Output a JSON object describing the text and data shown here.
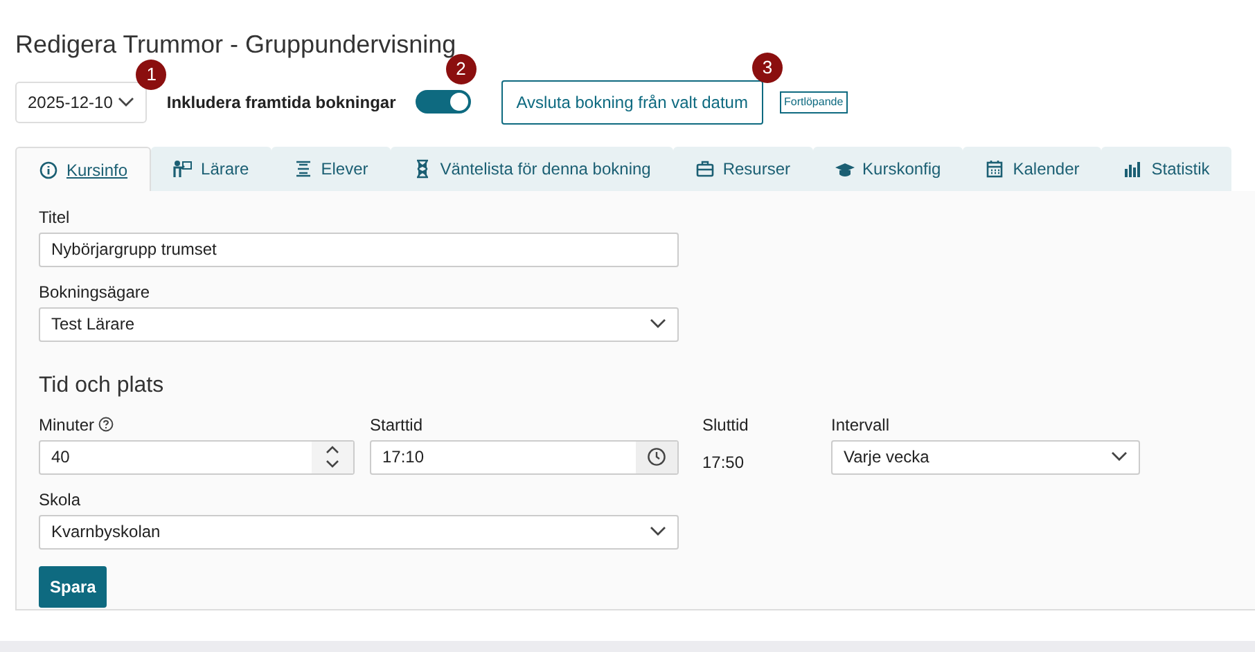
{
  "title": "Redigera Trummor - Gruppundervisning",
  "toolbar": {
    "date": "2025-12-10",
    "include_label": "Inkludera framtida bokningar",
    "include_on": true,
    "end_button": "Avsluta bokning från valt datum",
    "status_tag": "Fortlöpande",
    "markers": [
      "1",
      "2",
      "3"
    ]
  },
  "tabs": [
    {
      "label": "Kursinfo",
      "kind": "info",
      "selected": true
    },
    {
      "label": "Lärare",
      "kind": "teacher",
      "selected": false
    },
    {
      "label": "Elever",
      "kind": "students",
      "selected": false
    },
    {
      "label": "Väntelista för denna bokning",
      "kind": "hourglass",
      "selected": false
    },
    {
      "label": "Resurser",
      "kind": "case",
      "selected": false
    },
    {
      "label": "Kurskonfig",
      "kind": "cap",
      "selected": false
    },
    {
      "label": "Kalender",
      "kind": "calendar",
      "selected": false
    },
    {
      "label": "Statistik",
      "kind": "stats",
      "selected": false
    }
  ],
  "form": {
    "title_label": "Titel",
    "title_value": "Nybörjargrupp trumset",
    "owner_label": "Bokningsägare",
    "owner_value": "Test Lärare",
    "section": "Tid och plats",
    "minutes_label": "Minuter",
    "minutes_value": "40",
    "start_label": "Starttid",
    "start_value": "17:10",
    "end_label": "Sluttid",
    "end_value": "17:50",
    "interval_label": "Intervall",
    "interval_value": "Varje vecka",
    "school_label": "Skola",
    "school_value": "Kvarnbyskolan",
    "save": "Spara"
  }
}
